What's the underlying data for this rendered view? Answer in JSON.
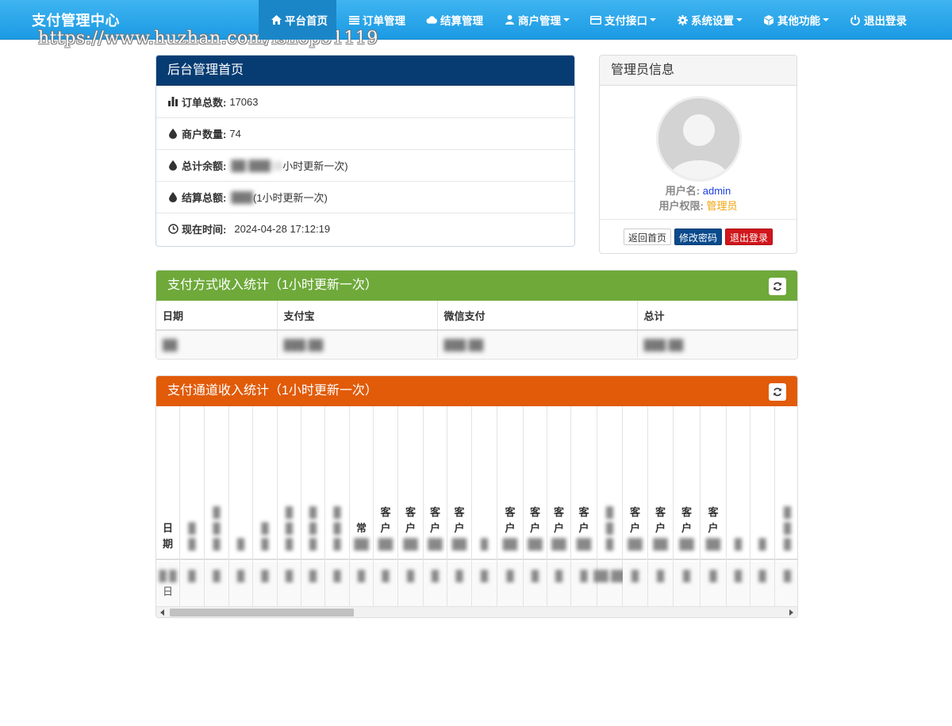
{
  "navbar": {
    "brand": "支付管理中心",
    "watermark": "https://www.huzhan.com/ishop51119",
    "items": [
      {
        "label": "平台首页",
        "icon": "home-icon",
        "active": true,
        "dropdown": false
      },
      {
        "label": "订单管理",
        "icon": "list-icon",
        "active": false,
        "dropdown": false
      },
      {
        "label": "结算管理",
        "icon": "cloud-icon",
        "active": false,
        "dropdown": false
      },
      {
        "label": "商户管理",
        "icon": "user-icon",
        "active": false,
        "dropdown": true
      },
      {
        "label": "支付接口",
        "icon": "credit-card-icon",
        "active": false,
        "dropdown": true
      },
      {
        "label": "系统设置",
        "icon": "gear-icon",
        "active": false,
        "dropdown": true
      },
      {
        "label": "其他功能",
        "icon": "cube-icon",
        "active": false,
        "dropdown": true
      },
      {
        "label": "退出登录",
        "icon": "power-icon",
        "active": false,
        "dropdown": false
      }
    ]
  },
  "admin_home": {
    "title": "后台管理首页",
    "rows": [
      {
        "icon": "bar-chart-icon",
        "label": "订单总数:",
        "value": "17063"
      },
      {
        "icon": "drop-icon",
        "label": "商户数量:",
        "value": "74"
      },
      {
        "icon": "drop-icon",
        "label": "总计余额:",
        "note": "小时更新一次)"
      },
      {
        "icon": "drop-icon",
        "label": "结算总额:",
        "note": "(1小时更新一次)"
      },
      {
        "icon": "clock-icon",
        "label": "现在时间:",
        "value": "2024-04-28 17:12:19"
      }
    ]
  },
  "admin_info": {
    "title": "管理员信息",
    "username_label": "用户名:",
    "username": "admin",
    "role_label": "用户权限:",
    "role": "管理员",
    "buttons": {
      "home": "返回首页",
      "change_password": "修改密码",
      "logout": "退出登录"
    }
  },
  "pay_method_stats": {
    "title": "支付方式收入统计（1小时更新一次）",
    "columns": [
      "日期",
      "支付宝",
      "微信支付",
      "总计"
    ]
  },
  "channel_stats": {
    "title": "支付通道收入统计（1小时更新一次）",
    "date_header": "日期",
    "date_cell": "日",
    "channel_headers": [
      "常",
      "客户",
      "客户",
      "客户",
      "客户",
      "客户",
      "客户",
      "客户",
      "客户",
      "客户",
      "客户",
      "客户",
      "客户"
    ]
  },
  "colors": {
    "navbar": "#1b9ae4",
    "panel_blue": "#073c73",
    "panel_green": "#6ea93a",
    "panel_orange": "#e15b09",
    "username": "#1a3ce0",
    "role": "#f0a30a"
  }
}
